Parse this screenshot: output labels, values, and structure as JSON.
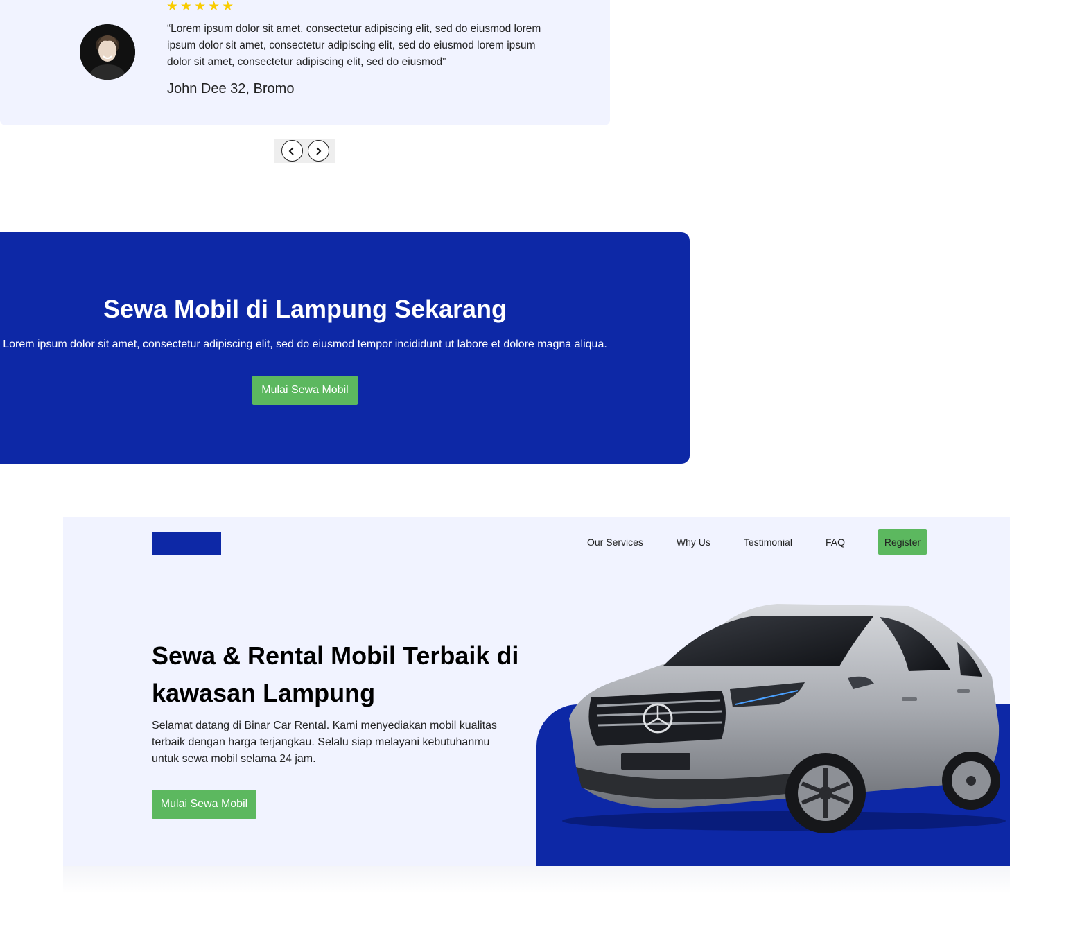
{
  "testimonial": {
    "stars": "★★★★★",
    "quote": "“Lorem ipsum dolor sit amet, consectetur adipiscing elit, sed do eiusmod lorem ipsum dolor sit amet, consectetur adipiscing elit, sed do eiusmod lorem ipsum dolor sit amet, consectetur adipiscing elit, sed do eiusmod”",
    "name": "John Dee 32, Bromo",
    "rating": 5
  },
  "carousel": {
    "prev_icon": "chevron-left-icon",
    "next_icon": "chevron-right-icon"
  },
  "cta": {
    "title": "Sewa Mobil di Lampung Sekarang",
    "description": "Lorem ipsum dolor sit amet, consectetur adipiscing elit, sed do eiusmod tempor incididunt ut labore et dolore magna aliqua.",
    "button_label": "Mulai Sewa Mobil"
  },
  "navbar": {
    "links": [
      "Our Services",
      "Why Us",
      "Testimonial",
      "FAQ"
    ],
    "register_label": "Register"
  },
  "hero": {
    "title": "Sewa & Rental Mobil Terbaik di kawasan Lampung",
    "description": "Selamat datang di Binar Car Rental. Kami menyediakan mobil kualitas terbaik dengan harga terjangkau. Selalu siap melayani kebutuhanmu untuk sewa mobil selama 24 jam.",
    "button_label": "Mulai Sewa Mobil"
  },
  "colors": {
    "primary": "#0D28A6",
    "accent": "#5CB85F",
    "light_bg": "#F1F3FF",
    "star": "#F9CC00"
  }
}
